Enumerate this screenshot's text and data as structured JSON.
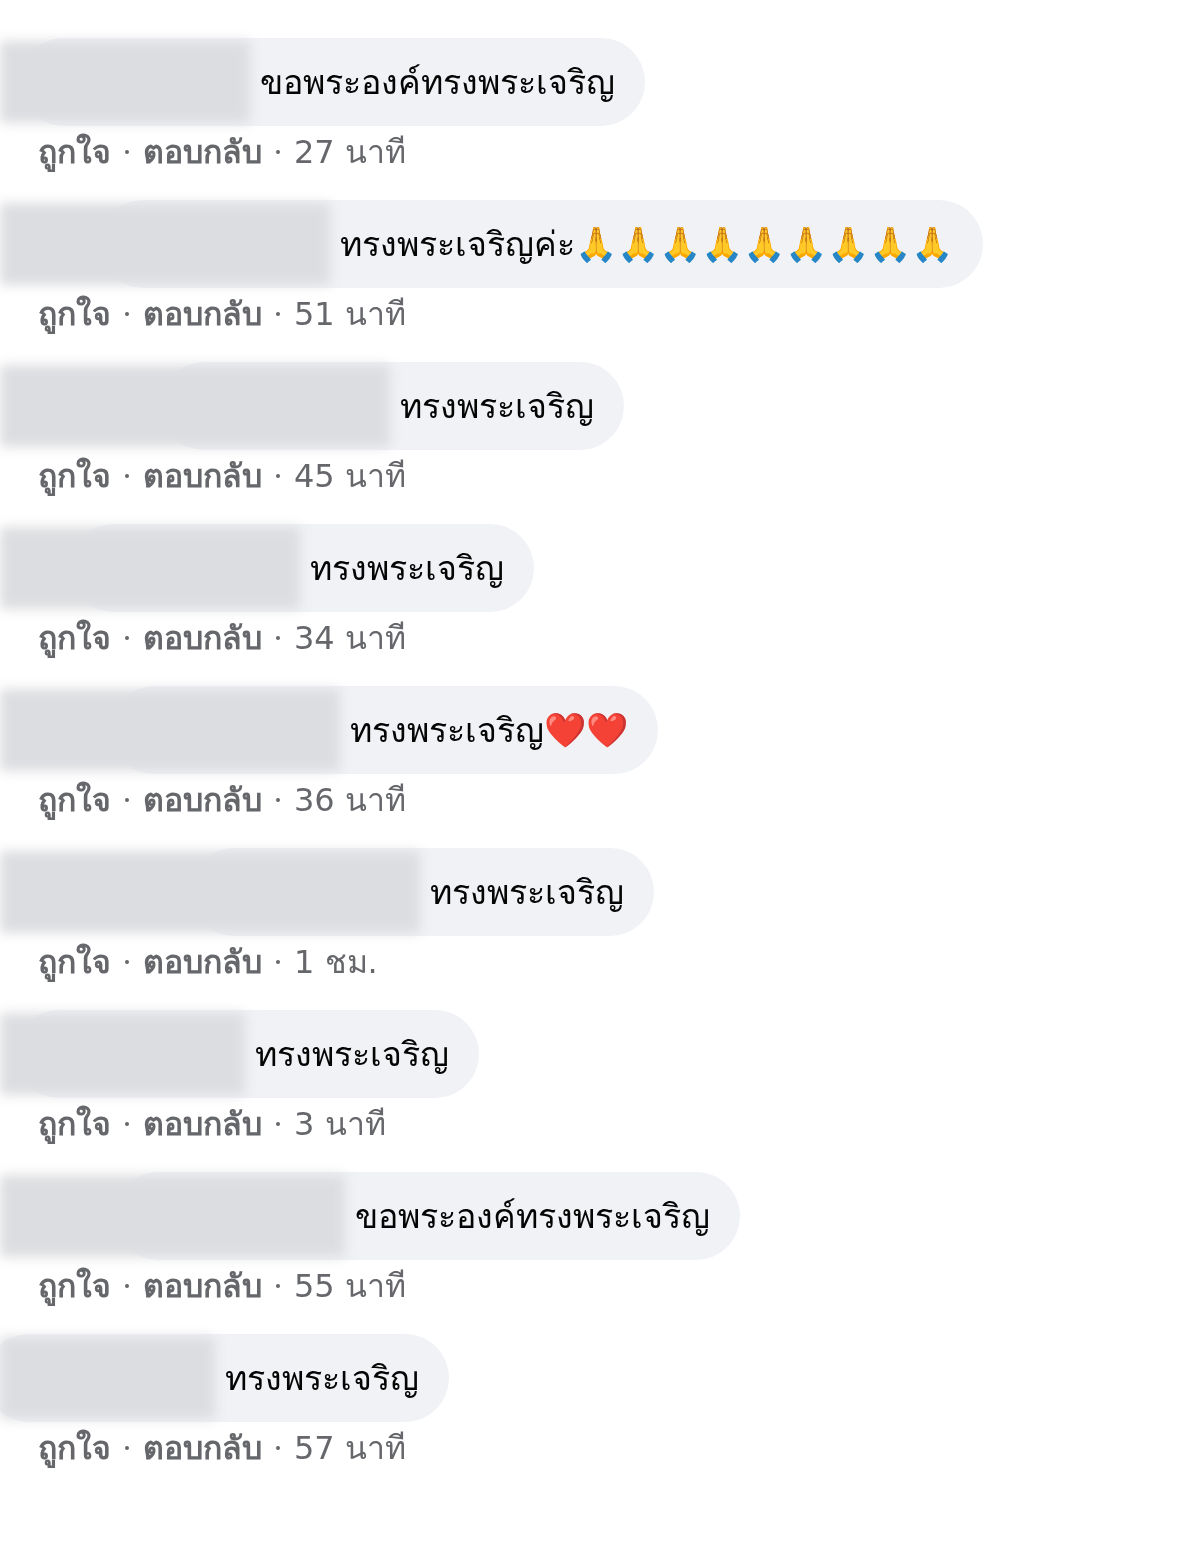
{
  "comments": [
    {
      "text": "ขอพระองค์ทรงพระเจริญ",
      "actions": [
        "ถูกใจ",
        "ตอบกลับ"
      ],
      "time": "27 นาที"
    },
    {
      "text": "ทรงพระเจริญค่ะ🙏🙏🙏🙏🙏🙏🙏🙏🙏",
      "actions": [
        "ถูกใจ",
        "ตอบกลับ"
      ],
      "time": "51 นาที"
    },
    {
      "text": "ทรงพระเจริญ",
      "actions": [
        "ถูกใจ",
        "ตอบกลับ"
      ],
      "time": "45 นาที"
    },
    {
      "text": "ทรงพระเจริญ",
      "actions": [
        "ถูกใจ",
        "ตอบกลับ"
      ],
      "time": "34 นาที"
    },
    {
      "text": "ทรงพระเจริญ❤️❤️",
      "actions": [
        "ถูกใจ",
        "ตอบกลับ"
      ],
      "time": "36 นาที"
    },
    {
      "text": "ทรงพระเจริญ",
      "actions": [
        "ถูกใจ",
        "ตอบกลับ"
      ],
      "time": "1 ชม."
    },
    {
      "text": "ทรงพระเจริญ",
      "actions": [
        "ถูกใจ",
        "ตอบกลับ"
      ],
      "time": "3 นาที"
    },
    {
      "text": "ขอพระองค์ทรงพระเจริญ",
      "actions": [
        "ถูกใจ",
        "ตอบกลับ"
      ],
      "time": "55 นาที"
    },
    {
      "text": "ทรงพระเจริญ",
      "actions": [
        "ถูกใจ",
        "ตอบกลับ"
      ],
      "time": "57 นาที"
    }
  ]
}
